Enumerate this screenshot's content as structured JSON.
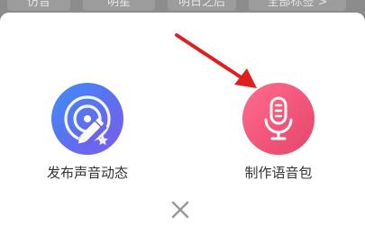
{
  "top_tags": [
    "仿音",
    "明星",
    "明日之后",
    "全部标签 >"
  ],
  "actions": {
    "left_label": "发布声音动态",
    "right_label": "制作语音包"
  },
  "colors": {
    "left_button": "#5a78f2",
    "right_button": "#f2557a",
    "arrow": "#e01e1e",
    "close": "#9a9a9a"
  },
  "icons": {
    "left": "voice-post-pencil-icon",
    "right": "microphone-icon",
    "close": "close-icon"
  }
}
